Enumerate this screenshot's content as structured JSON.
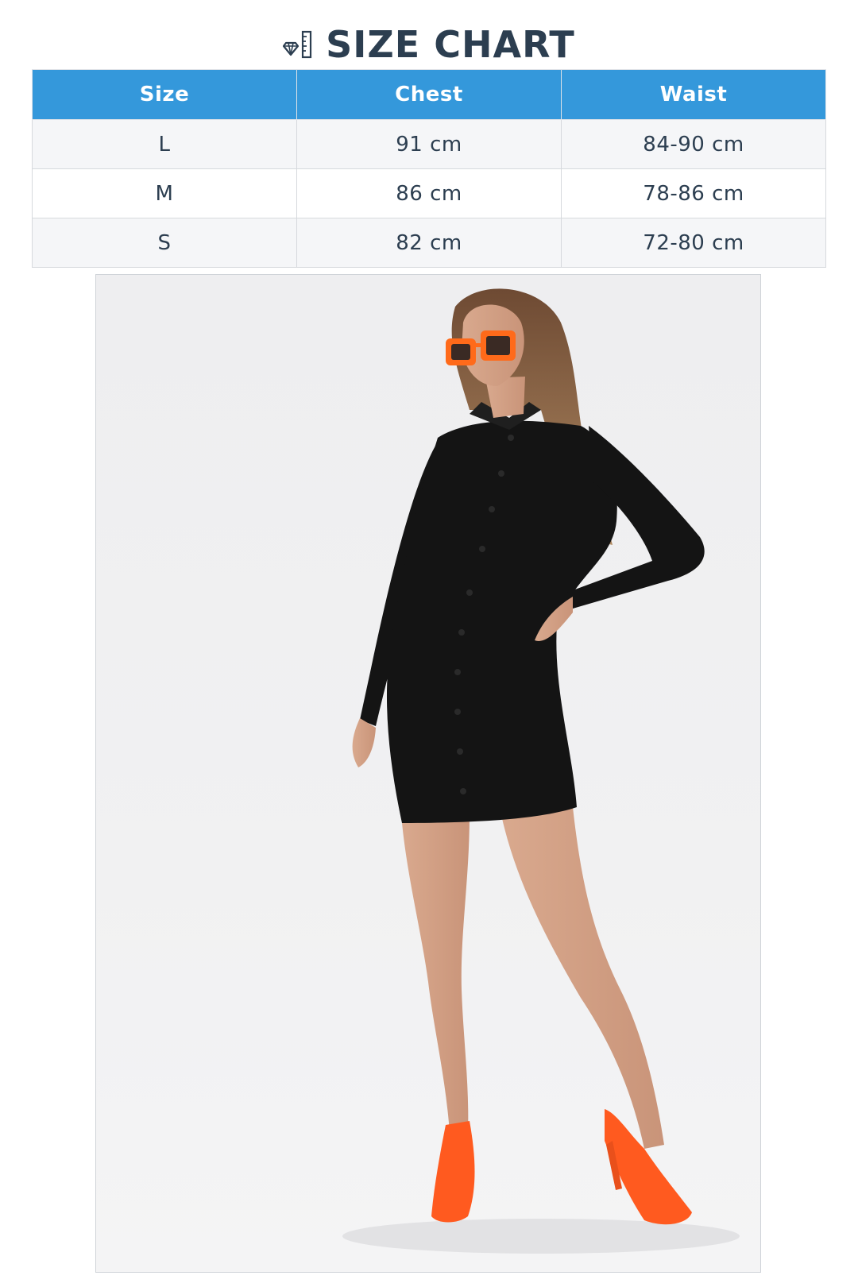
{
  "header": {
    "title": "SIZE CHART",
    "icon": "ruler-diamond-icon"
  },
  "table": {
    "columns": [
      "Size",
      "Chest",
      "Waist"
    ],
    "rows": [
      {
        "size": "L",
        "chest": "91 cm",
        "waist": "84-90 cm"
      },
      {
        "size": "M",
        "chest": "86 cm",
        "waist": "78-86 cm"
      },
      {
        "size": "S",
        "chest": "82 cm",
        "waist": "72-80 cm"
      }
    ]
  },
  "colors": {
    "header_bg": "#3498db",
    "title_text": "#2c3e50",
    "dress": "#141414",
    "accent_orange": "#ff5a1f"
  },
  "photo": {
    "subject": "model-black-shirt-dress-orange-accessories"
  }
}
